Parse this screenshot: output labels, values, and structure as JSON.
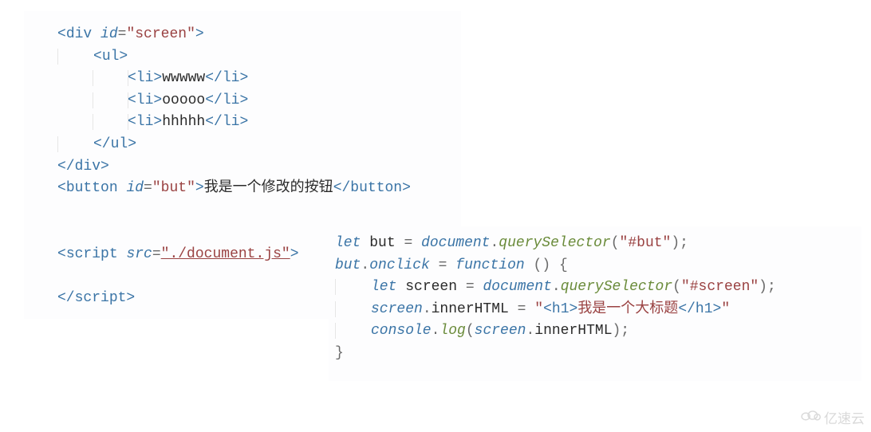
{
  "leftCode": {
    "divOpen": {
      "tag": "div",
      "attr": "id",
      "val": "\"screen\""
    },
    "ulOpen": "ul",
    "liItems": [
      "wwwww",
      "ooooo",
      "hhhhh"
    ],
    "ulClose": "ul",
    "divClose": "div",
    "buttonOpen": {
      "tag": "button",
      "attr": "id",
      "val": "\"but\""
    },
    "buttonText": "我是一个修改的按钮",
    "buttonClose": "button",
    "scriptOpen": {
      "tag": "script",
      "attr": "src",
      "val": "\"./document.js\""
    },
    "scriptClose": "script"
  },
  "rightCode": {
    "line1": {
      "kw": "let",
      "var1": "but",
      "eq": "=",
      "obj": "document",
      "method": "querySelector",
      "arg": "\"#but\""
    },
    "line2": {
      "obj": "but",
      "prop": "onclick",
      "eq": "=",
      "kw": "function",
      "parens": "()",
      "brace": "{"
    },
    "line3": {
      "kw": "let",
      "var1": "screen",
      "eq": "=",
      "obj": "document",
      "method": "querySelector",
      "arg": "\"#screen\""
    },
    "line4": {
      "obj": "screen",
      "prop": "innerHTML",
      "eq": "=",
      "strOpen": "\"",
      "tagOpen": "<h1>",
      "text": "我是一个大标题",
      "tagClose": "</h1>",
      "strClose": "\""
    },
    "line5": {
      "obj": "console",
      "method": "log",
      "argObj": "screen",
      "argProp": "innerHTML"
    },
    "line6": {
      "brace": "}"
    }
  },
  "watermark": "亿速云"
}
